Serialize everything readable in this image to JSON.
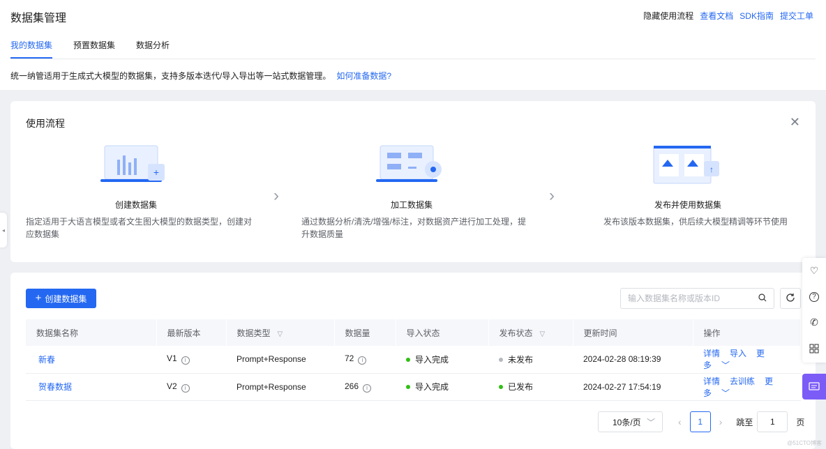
{
  "header": {
    "title": "数据集管理",
    "links": [
      "隐藏使用流程",
      "查看文档",
      "SDK指南",
      "提交工单"
    ]
  },
  "tabs": [
    "我的数据集",
    "预置数据集",
    "数据分析"
  ],
  "description": {
    "text": "统一纳管适用于生成式大模型的数据集，支持多版本迭代/导入导出等一站式数据管理。",
    "link": "如何准备数据?"
  },
  "flow": {
    "title": "使用流程",
    "steps": [
      {
        "title": "创建数据集",
        "desc": "指定适用于大语言模型或者文生图大模型的数据类型，创建对应数据集"
      },
      {
        "title": "加工数据集",
        "desc": "通过数据分析/清洗/增强/标注，对数据资产进行加工处理，提升数据质量"
      },
      {
        "title": "发布并使用数据集",
        "desc": "发布该版本数据集，供后续大模型精调等环节使用"
      }
    ]
  },
  "toolbar": {
    "create_label": "创建数据集",
    "search_placeholder": "输入数据集名称或版本ID"
  },
  "table": {
    "columns": [
      "数据集名称",
      "最新版本",
      "数据类型",
      "数据量",
      "导入状态",
      "发布状态",
      "更新时间",
      "操作"
    ],
    "rows": [
      {
        "name": "新春",
        "version": "V1",
        "type": "Prompt+Response",
        "count": "72",
        "import": "导入完成",
        "publish": "未发布",
        "publish_color": "#b4b8bf",
        "time": "2024-02-28 08:19:39",
        "ops": [
          "详情",
          "导入",
          "更多"
        ]
      },
      {
        "name": "贺春数据",
        "version": "V2",
        "type": "Prompt+Response",
        "count": "266",
        "import": "导入完成",
        "publish": "已发布",
        "publish_color": "#30bf13",
        "time": "2024-02-27 17:54:19",
        "ops": [
          "详情",
          "去训练",
          "更多"
        ]
      }
    ]
  },
  "pagination": {
    "page_size": "10条/页",
    "current": "1",
    "jump_label": "跳至",
    "jump_value": "1",
    "unit": "页"
  },
  "colors": {
    "accent": "#2468f2",
    "success": "#30bf13",
    "chat": "#7c5cf6"
  },
  "watermark": "@51CTO博客"
}
